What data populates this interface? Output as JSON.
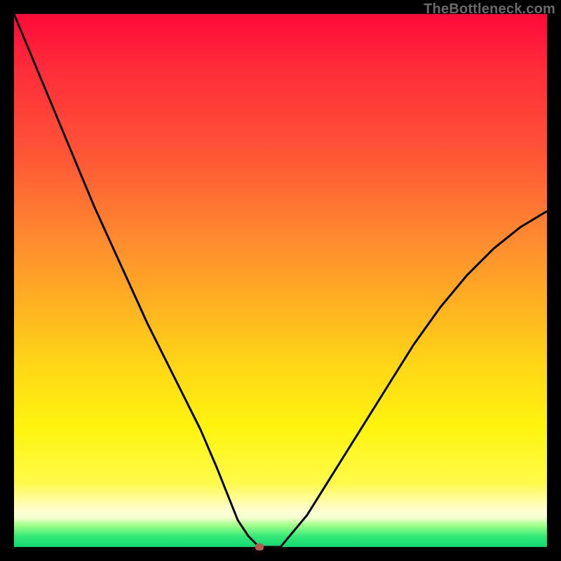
{
  "watermark": "TheBottleneck.com",
  "colors": {
    "curve_stroke": "#000000",
    "marker_fill": "#b85a4a",
    "frame_bg": "#000000"
  },
  "chart_data": {
    "type": "line",
    "title": "",
    "xlabel": "",
    "ylabel": "",
    "xlim": [
      0,
      100
    ],
    "ylim": [
      0,
      100
    ],
    "grid": false,
    "legend": false,
    "series": [
      {
        "name": "bottleneck-curve",
        "x": [
          0,
          5,
          10,
          15,
          20,
          25,
          30,
          35,
          38,
          40,
          42,
          44,
          46,
          50,
          55,
          60,
          65,
          70,
          75,
          80,
          85,
          90,
          95,
          100
        ],
        "values": [
          100,
          88,
          76,
          64,
          53,
          42,
          32,
          22,
          15,
          10,
          5,
          2,
          0,
          0,
          6,
          14,
          22,
          30,
          38,
          45,
          51,
          56,
          60,
          63
        ]
      }
    ],
    "annotations": [
      {
        "name": "min-marker",
        "x": 46,
        "y": 0
      }
    ]
  }
}
